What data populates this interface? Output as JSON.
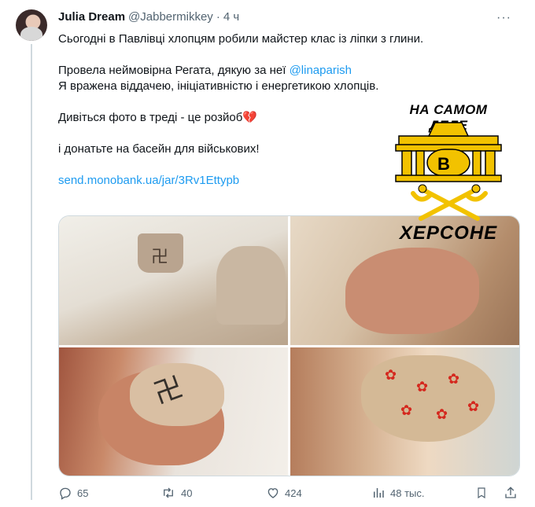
{
  "tweet": {
    "author_name": "Julia Dream",
    "author_handle": "@Jabbermikkey",
    "separator": "·",
    "time": "4 ч",
    "more": "···",
    "line1": "Сьогодні в Павлівці хлопцям робили майстер клас із ліпки з глини.",
    "line2_prefix": "Провела неймовірна Регата, дякую за неї ",
    "mention": "@linaparish",
    "line3": "Я вражена віддачею, ініціативністю і енергетикою хлопців.",
    "line4": "Дивіться фото в треді - це розйоб",
    "line4_emoji": "💔",
    "line5": "і донатьте на басейн для військових!",
    "link": "send.monobank.ua/jar/3Rv1Ettypb"
  },
  "overlay": {
    "top_text": "НА САМОМ ДЕЛЕ",
    "middle_letter": "В",
    "bottom_text": "ХЕРСОНЕ",
    "gold": "#f2c200"
  },
  "actions": {
    "replies": "65",
    "reposts": "40",
    "likes": "424",
    "views": "48 тыс."
  },
  "colors": {
    "text": "#0f1419",
    "secondary": "#536471",
    "link": "#1d9bf0"
  }
}
